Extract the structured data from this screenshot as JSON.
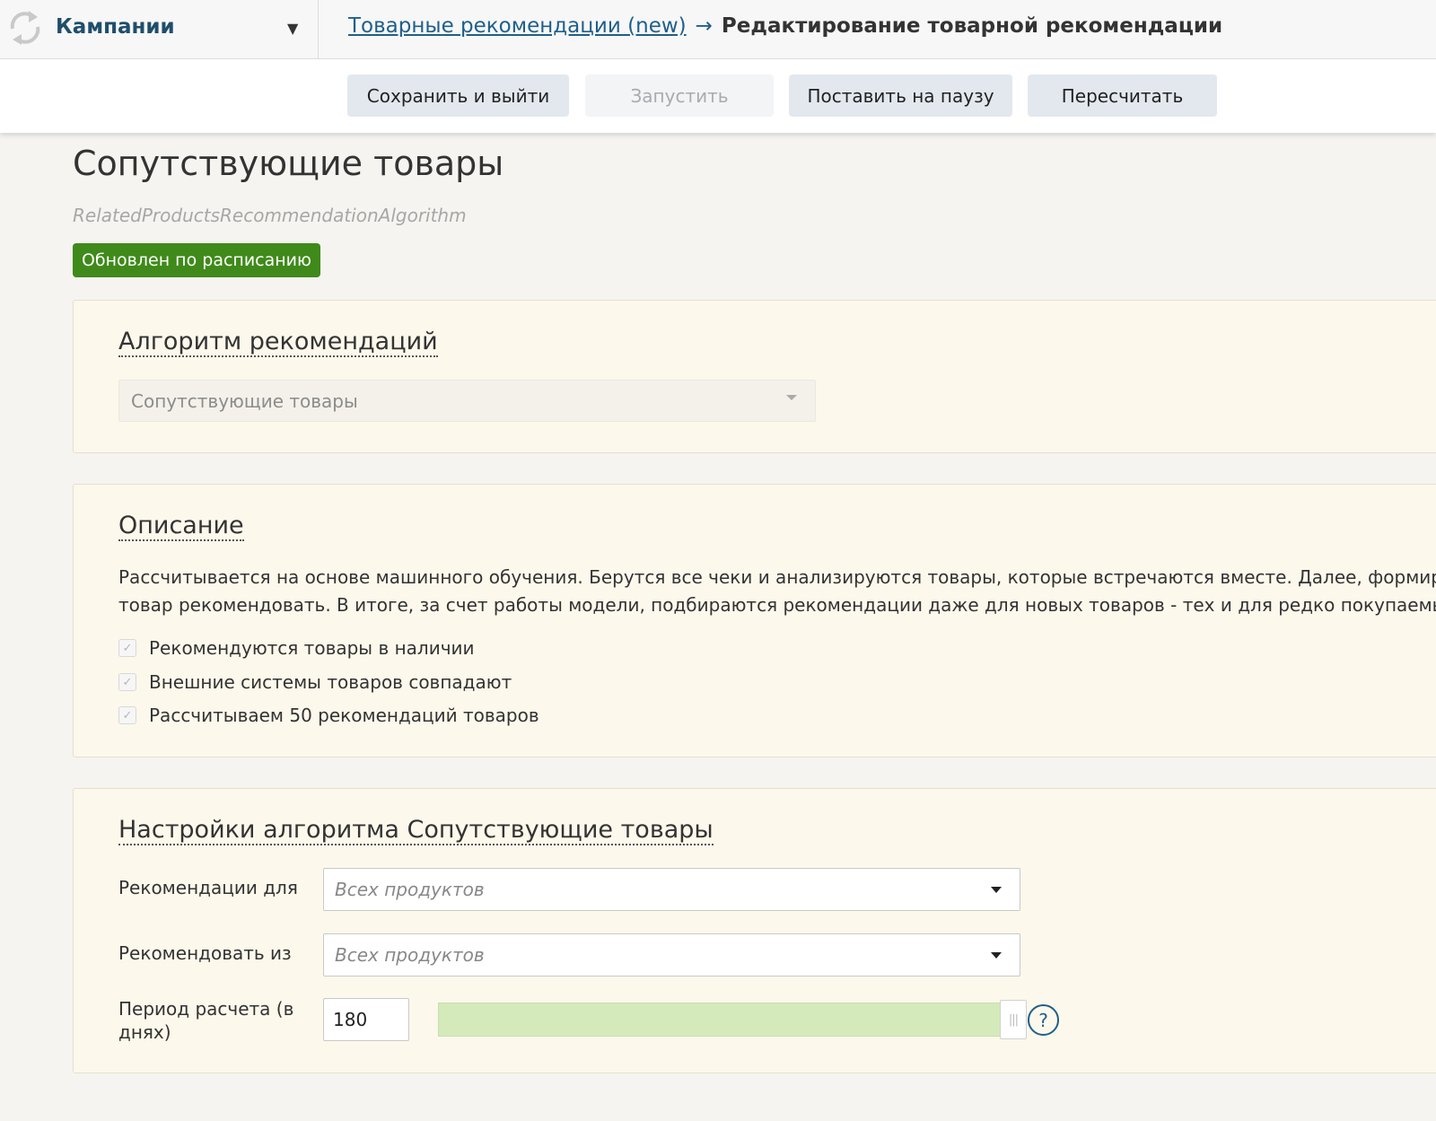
{
  "header": {
    "campaign_label": "Кампании",
    "breadcrumb_link": "Товарные рекомендации (new)",
    "breadcrumb_arrow": "→",
    "breadcrumb_current": "Редактирование товарной рекомендации"
  },
  "toolbar": {
    "save_exit": "Сохранить и выйти",
    "launch": "Запустить",
    "pause": "Поставить на паузу",
    "recalculate": "Пересчитать"
  },
  "page": {
    "title": "Сопутствующие товары",
    "subtitle": "RelatedProductsRecommendationAlgorithm",
    "status_badge": "Обновлен по расписанию",
    "status_color": "#3f8a1a"
  },
  "algorithm_panel": {
    "title": "Алгоритм рекомендаций",
    "selected": "Сопутствующие товары"
  },
  "description_panel": {
    "title": "Описание",
    "line1": "Рассчитывается на основе машинного обучения. Берутся все чеки и анализируются товары, которые встречаются вместе. Далее, формируется",
    "line2": "товар рекомендовать. В итоге, за счет работы модели, подбираются рекомендации даже для новых товаров - тех и для редко покупаемых то",
    "checks": [
      "Рекомендуются товары в наличии",
      "Внешние системы товаров совпадают",
      "Рассчитываем 50 рекомендаций товаров"
    ],
    "check_mark": "✓"
  },
  "settings_panel": {
    "title": "Настройки алгоритма Сопутствующие товары",
    "recommend_for_label": "Рекомендации для",
    "recommend_for_value": "Всех продуктов",
    "recommend_from_label": "Рекомендовать из",
    "recommend_from_value": "Всех продуктов",
    "period_label": "Период расчета (в днях)",
    "period_value": "180",
    "period_slider_fraction": 1.0,
    "help_glyph": "?"
  }
}
